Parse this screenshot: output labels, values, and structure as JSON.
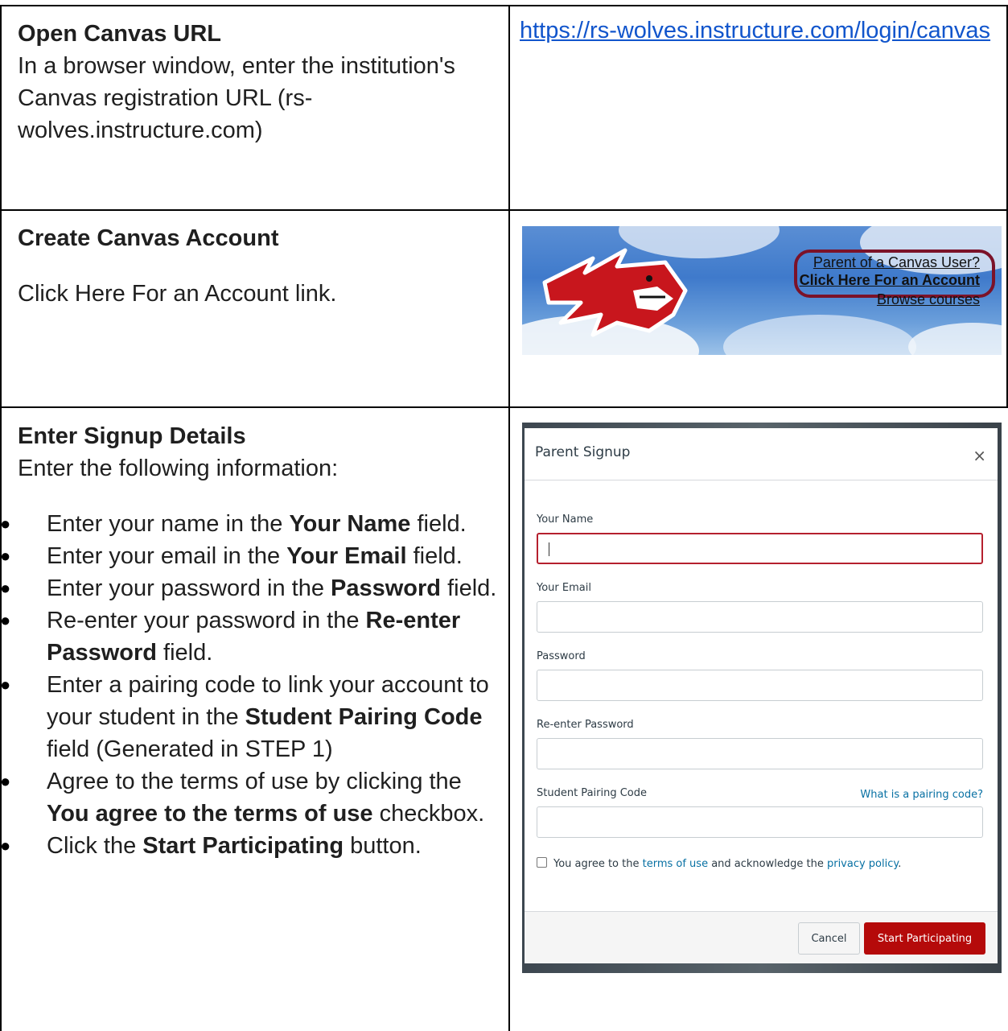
{
  "rows": [
    {
      "heading": "Open Canvas URL",
      "body": "In a browser window, enter the institution's Canvas registration URL (rs-wolves.instructure.com)",
      "link": "https://rs-wolves.instructure.com/login/canvas"
    },
    {
      "heading": "Create Canvas Account",
      "body": "Click Here For an Account link.",
      "banner": {
        "parent_link": "Parent of a Canvas User?",
        "account_link": "Click Here For an Account",
        "browse_link": "Browse courses"
      }
    },
    {
      "heading": "Enter Signup Details",
      "body": "Enter the following information:",
      "steps": [
        {
          "pre": "Enter your name in the ",
          "bold": "Your Name",
          "post": " field."
        },
        {
          "pre": "Enter your email in the ",
          "bold": "Your Email",
          "post": " field."
        },
        {
          "pre": "Enter your password in the ",
          "bold": "Password",
          "post": " field."
        },
        {
          "pre": "Re-enter your password in the ",
          "bold": "Re-enter Password",
          "post": " field."
        },
        {
          "pre": "Enter a pairing code to link your account to your student in the ",
          "bold": "Student Pairing Code",
          "post": " field (Generated in STEP 1)"
        },
        {
          "pre": "Agree to the terms of use by clicking the ",
          "bold": "You agree to the terms of use",
          "post": " checkbox."
        },
        {
          "pre": "Click the ",
          "bold": "Start Participating",
          "post": " button."
        }
      ]
    }
  ],
  "signup": {
    "title": "Parent Signup",
    "close": "×",
    "fields": [
      {
        "label": "Your Name"
      },
      {
        "label": "Your Email"
      },
      {
        "label": "Password"
      },
      {
        "label": "Re-enter Password"
      },
      {
        "label": "Student Pairing Code"
      }
    ],
    "pairing_help": "What is a pairing code?",
    "terms": {
      "prefix": "You agree to the ",
      "terms_link": "terms of use",
      "middle": " and acknowledge the ",
      "privacy_link": "privacy policy",
      "suffix": "."
    },
    "cancel": "Cancel",
    "start": "Start Participating"
  },
  "colors": {
    "link": "#1155cc",
    "start_button": "#b50a0a",
    "active_field_border": "#b5202e",
    "highlight_ring": "#7b1229"
  }
}
